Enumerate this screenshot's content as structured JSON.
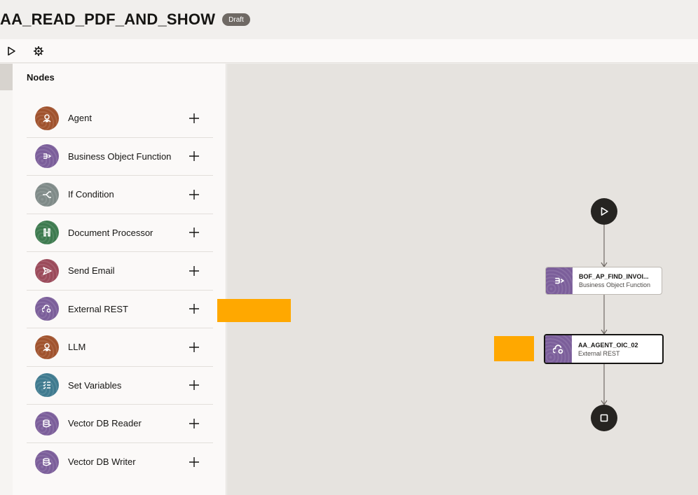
{
  "header": {
    "title": "AA_READ_PDF_AND_SHOW",
    "badge": "Draft"
  },
  "toolbar": {
    "run_icon": "play-icon",
    "settings_icon": "gear-icon"
  },
  "palette": {
    "title": "Nodes",
    "items": [
      {
        "label": "Agent",
        "icon": "agent-icon",
        "color": "#a0522d"
      },
      {
        "label": "Business Object Function",
        "icon": "business-object-function-icon",
        "color": "#7b5e9a"
      },
      {
        "label": "If Condition",
        "icon": "if-condition-icon",
        "color": "#7f8a88"
      },
      {
        "label": "Document Processor",
        "icon": "document-processor-icon",
        "color": "#3d7a4f"
      },
      {
        "label": "Send Email",
        "icon": "send-email-icon",
        "color": "#9b4a5a"
      },
      {
        "label": "External REST",
        "icon": "external-rest-icon",
        "color": "#7b5e9a"
      },
      {
        "label": "LLM",
        "icon": "llm-icon",
        "color": "#a0522d"
      },
      {
        "label": "Set Variables",
        "icon": "set-variables-icon",
        "color": "#3f7a8f"
      },
      {
        "label": "Vector DB Reader",
        "icon": "vector-db-reader-icon",
        "color": "#7b5e9a"
      },
      {
        "label": "Vector DB Writer",
        "icon": "vector-db-writer-icon",
        "color": "#7b5e9a"
      }
    ]
  },
  "canvas": {
    "nodes": [
      {
        "name": "BOF_AP_FIND_INVOI...",
        "type": "Business Object Function",
        "icon": "business-object-function-icon"
      },
      {
        "name": "AA_AGENT_OIC_02",
        "type": "External REST",
        "icon": "external-rest-icon"
      }
    ]
  }
}
